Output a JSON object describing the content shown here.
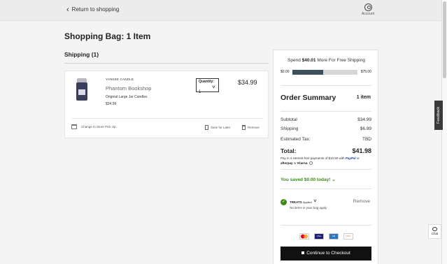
{
  "header": {
    "back_label": "Return to shopping",
    "account_label": "Account"
  },
  "page": {
    "title": "Shopping Bag: 1 Item",
    "shipping_heading": "Shipping (1)"
  },
  "item": {
    "brand": "YANKEE CANDLE",
    "name": "Phantom Bookshop",
    "type": "Original Large Jar Candles",
    "unit_price": "$34.99",
    "quantity_label": "Quantity:",
    "quantity_value": "1",
    "line_price": "$34.99",
    "store_pickup_label": "Change to Store Pick Up",
    "save_label": "Save for Later",
    "remove_label": "Remove"
  },
  "summary": {
    "spend_prefix": "Spend ",
    "spend_amount": "$40.01",
    "spend_suffix": " More For Free Shipping",
    "progress_min": "$0.00",
    "progress_max": "$75.00",
    "progress_fraction": 0.47,
    "title": "Order Summary",
    "item_count": "1 item",
    "subtotal_label": "Subtotal",
    "subtotal_value": "$34.99",
    "shipping_label": "Shipping",
    "shipping_value": "$6.99",
    "tax_label": "Estimated Tax:",
    "tax_value": "TBD",
    "total_label": "Total:",
    "total_value": "$41.98",
    "pay4_text": "Pay in 4 interest-free payments of $10.50 with",
    "paypal": "PayPal",
    "pay4_or": "or",
    "afterpay": "afterpay",
    "or2": "or",
    "klarna": "Klarna.",
    "saved_text": "You saved $0.00 today!",
    "treats_label": "TREATS",
    "treats_applied": "Applied",
    "treats_remove": "Remove",
    "treats_none": "No items in your bag apply",
    "checkout_label": "Continue to Checkout"
  },
  "payment_cards": [
    {
      "name": "mastercard",
      "color": "#eb001b"
    },
    {
      "name": "visa",
      "color": "#1a1f71"
    },
    {
      "name": "amex",
      "color": "#2e77bb"
    },
    {
      "name": "discover",
      "color": "#f68121"
    }
  ],
  "widgets": {
    "feedback_label": "Feedback",
    "chat_label": "Chat"
  }
}
